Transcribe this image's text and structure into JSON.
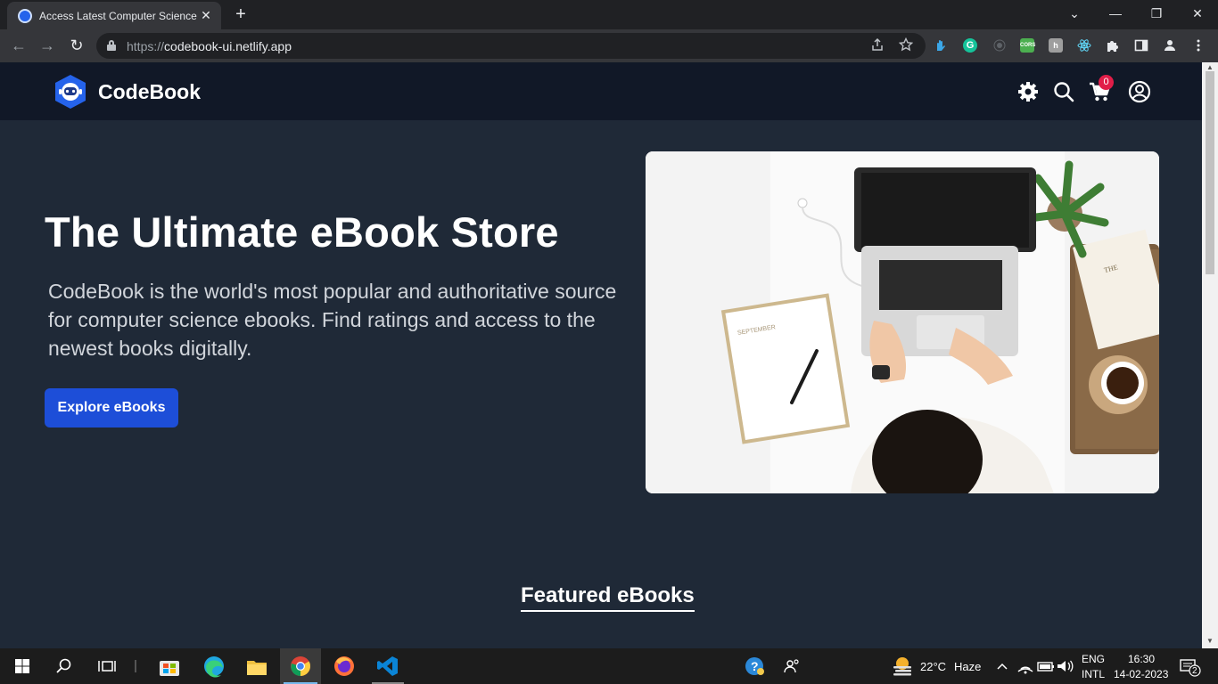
{
  "browser": {
    "tab_title": "Access Latest Computer Science eBooks",
    "url_scheme": "https://",
    "url_host": "codebook-ui.netlify.app",
    "new_tab": "+",
    "tab_close": "✕",
    "window_controls": {
      "chevron": "⌄",
      "minimize": "—",
      "restore": "❐",
      "close": "✕"
    },
    "nav": {
      "back": "←",
      "forward": "→",
      "reload": "↻"
    },
    "omnibox_icons": [
      "share-icon",
      "bookmark-star-icon"
    ],
    "extensions": [
      "extension-hand-icon",
      "grammarly-icon",
      "extension-dot-icon",
      "cors-icon",
      "extension-h-icon",
      "react-devtools-icon",
      "extensions-puzzle-icon",
      "side-panel-icon",
      "profile-icon",
      "menu-icon"
    ],
    "extension_labels": {
      "grammarly": "G",
      "cors": "CORS",
      "h": "h"
    }
  },
  "site": {
    "brand": "CodeBook",
    "cart_count": "0",
    "header_icons": [
      "gear-icon",
      "search-icon",
      "cart-icon",
      "user-icon"
    ]
  },
  "hero": {
    "title": "The Ultimate eBook Store",
    "text": "CodeBook is the world's most popular and authoritative source for computer science ebooks. Find ratings and access to the newest books digitally.",
    "button": "Explore eBooks"
  },
  "featured": {
    "title": "Featured eBooks"
  },
  "taskbar": {
    "apps": [
      "windows-start-icon",
      "search-icon",
      "task-view-icon",
      "microsoft-store-icon",
      "edge-icon",
      "file-explorer-icon",
      "chrome-icon",
      "firefox-icon",
      "vscode-icon"
    ],
    "weather": "22°C",
    "weather_desc": "Haze",
    "lang_1": "ENG",
    "lang_2": "INTL",
    "time": "16:30",
    "date": "14-02-2023",
    "notifications": "2"
  },
  "colors": {
    "header_bg": "#111827",
    "page_bg": "#1f2937",
    "button_blue": "#1d4ed8",
    "badge_red": "#e11d48"
  }
}
